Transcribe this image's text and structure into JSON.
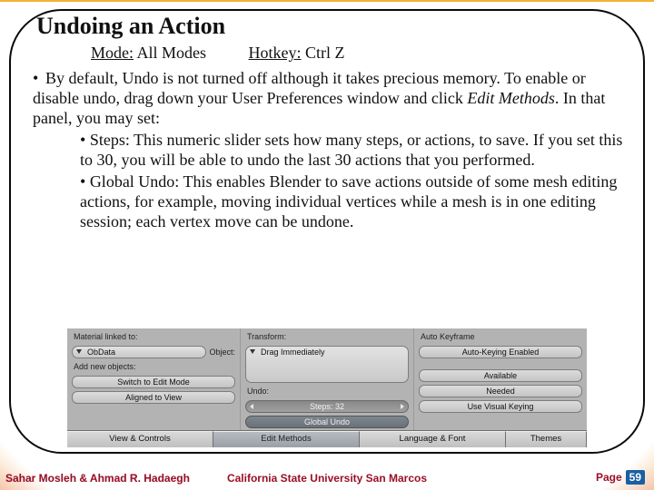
{
  "slide": {
    "title": "Undoing an Action",
    "mode_label": "Mode:",
    "mode_value": "All Modes",
    "hotkey_label": "Hotkey:",
    "hotkey_value": "Ctrl Z",
    "body_lead": "By default, Undo is not turned off although it takes precious memory. To enable or disable undo, drag down your User Preferences window and click ",
    "body_italic": "Edit Methods",
    "body_tail": ". In that panel, you may set:",
    "bullets": [
      "Steps: This numeric slider sets how many steps, or actions, to save. If you set this to 30, you will be able to undo the last 30 actions that you performed.",
      "Global Undo: This enables Blender to save actions outside of some mesh editing actions, for example, moving individual vertices while a mesh is in one editing session; each vertex move can be undone."
    ]
  },
  "pref": {
    "col1": {
      "section1": "Material linked to:",
      "menu1": "ObData",
      "section2": "Add new objects:",
      "btn1": "Switch to Edit Mode",
      "btn2": "Aligned to View"
    },
    "col2": {
      "section1": "Transform:",
      "menu1": "Drag Immediately",
      "section2": "Undo:",
      "num_label": "Steps:",
      "num_value": "32",
      "toggle": "Global Undo"
    },
    "col3": {
      "section1": "Auto Keyframe",
      "btn1": "Auto-Keying Enabled",
      "gap": "",
      "btn2": "Available",
      "btn3": "Needed",
      "btn4": "Use Visual Keying"
    },
    "col4_label": "Object:",
    "tabs": [
      "View & Controls",
      "Edit Methods",
      "Language & Font",
      "Themes"
    ],
    "active_tab": 1
  },
  "footer": {
    "authors": "Sahar Mosleh & Ahmad R. Hadaegh",
    "institution": "California State University San Marcos",
    "page_label": "Page",
    "page_number": "59"
  }
}
